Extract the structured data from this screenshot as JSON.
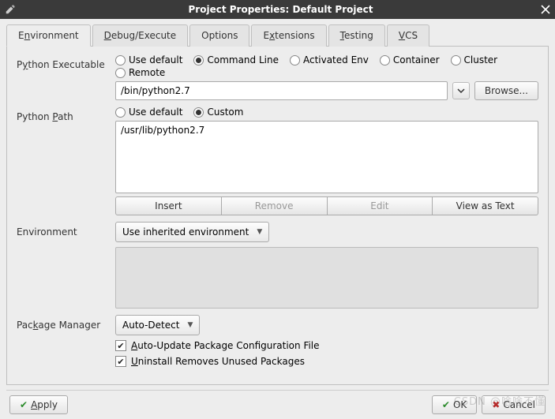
{
  "titlebar": {
    "title": "Project Properties: Default Project"
  },
  "tabs": [
    {
      "label_pre": "E",
      "label_u": "n",
      "label_post": "vironment",
      "active": true
    },
    {
      "label_pre": "",
      "label_u": "D",
      "label_post": "ebug/Execute",
      "active": false
    },
    {
      "label_pre": "Options",
      "label_u": "",
      "label_post": "",
      "active": false
    },
    {
      "label_pre": "E",
      "label_u": "x",
      "label_post": "tensions",
      "active": false
    },
    {
      "label_pre": "",
      "label_u": "T",
      "label_post": "esting",
      "active": false
    },
    {
      "label_pre": "",
      "label_u": "V",
      "label_post": "CS",
      "active": false
    }
  ],
  "labels": {
    "python_exec_pre": "P",
    "python_exec_u": "y",
    "python_exec_post": "thon Executable",
    "python_path_pre": "Python ",
    "python_path_u": "P",
    "python_path_post": "ath",
    "environment": "Environment",
    "pkg_mgr_pre": "Pac",
    "pkg_mgr_u": "k",
    "pkg_mgr_post": "age Manager"
  },
  "exec_radios": {
    "use_default": "Use default",
    "command_line": "Command Line",
    "activated_env": "Activated Env",
    "container": "Container",
    "cluster": "Cluster",
    "remote": "Remote",
    "selected": "command_line"
  },
  "exec_value": "/bin/python2.7",
  "browse_label": "Browse...",
  "path_radios": {
    "use_default": "Use default",
    "custom": "Custom",
    "selected": "custom"
  },
  "path_items": [
    "/usr/lib/python2.7"
  ],
  "path_buttons": {
    "insert": "Insert",
    "remove": "Remove",
    "edit": "Edit",
    "view_as_text": "View as Text"
  },
  "env_select": "Use inherited environment",
  "pkg_select": "Auto-Detect",
  "pkg_checks": {
    "auto_update_pre": "",
    "auto_update_u": "A",
    "auto_update_post": "uto-Update Package Configuration File",
    "uninstall_pre": "",
    "uninstall_u": "U",
    "uninstall_post": "ninstall Removes Unused Packages"
  },
  "footer": {
    "apply_u": "A",
    "apply_post": "pply",
    "ok": "OK",
    "cancel": "Cancel"
  },
  "watermark": "CSDN @啥啥不懂"
}
